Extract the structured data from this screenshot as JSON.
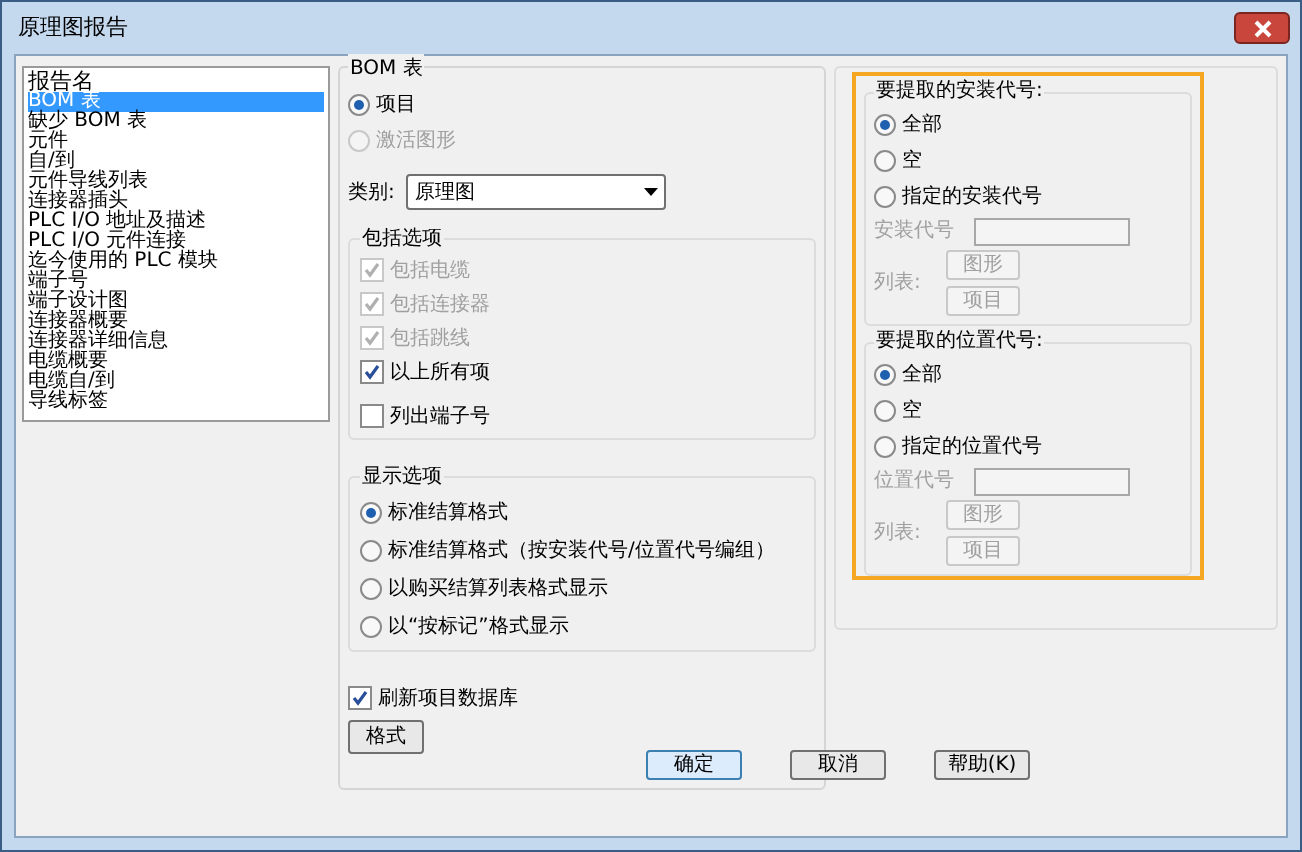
{
  "window": {
    "title": "原理图报告"
  },
  "report_list": {
    "label": "报告名",
    "items": [
      {
        "label": "BOM 表",
        "selected": true
      },
      {
        "label": "缺少 BOM 表",
        "selected": false
      },
      {
        "label": "元件",
        "selected": false
      },
      {
        "label": "自/到",
        "selected": false
      },
      {
        "label": "元件导线列表",
        "selected": false
      },
      {
        "label": "连接器插头",
        "selected": false
      },
      {
        "label": "PLC I/O 地址及描述",
        "selected": false
      },
      {
        "label": "PLC I/O 元件连接",
        "selected": false
      },
      {
        "label": "迄今使用的 PLC 模块",
        "selected": false
      },
      {
        "label": "端子号",
        "selected": false
      },
      {
        "label": "端子设计图",
        "selected": false
      },
      {
        "label": "连接器概要",
        "selected": false
      },
      {
        "label": "连接器详细信息",
        "selected": false
      },
      {
        "label": "电缆概要",
        "selected": false
      },
      {
        "label": "电缆自/到",
        "selected": false
      },
      {
        "label": "导线标签",
        "selected": false
      }
    ]
  },
  "bom": {
    "title": "BOM 表",
    "options": [
      {
        "label": "项目",
        "selected": true,
        "disabled": false
      },
      {
        "label": "激活图形",
        "selected": false,
        "disabled": true
      }
    ],
    "category": {
      "label": "类别:",
      "value": "原理图"
    }
  },
  "include_options": {
    "title": "包括选项",
    "items": [
      {
        "label": "包括电缆",
        "checked": true,
        "disabled": true
      },
      {
        "label": "包括连接器",
        "checked": true,
        "disabled": true
      },
      {
        "label": "包括跳线",
        "checked": true,
        "disabled": true
      },
      {
        "label": "以上所有项",
        "checked": true,
        "disabled": false
      },
      {
        "label": "列出端子号",
        "checked": false,
        "disabled": false
      }
    ]
  },
  "display_options": {
    "title": "显示选项",
    "options": [
      {
        "label": "标准结算格式",
        "selected": true
      },
      {
        "label": "标准结算格式（按安装代号/位置代号编组）",
        "selected": false
      },
      {
        "label": "以购买结算列表格式显示",
        "selected": false
      },
      {
        "label": "以“按标记”格式显示",
        "selected": false
      }
    ]
  },
  "refresh": {
    "label": "刷新项目数据库",
    "checked": true
  },
  "format_button": "格式",
  "code_groups": [
    {
      "title": "要提取的安装代号:",
      "options": [
        {
          "label": "全部",
          "selected": true
        },
        {
          "label": "空",
          "selected": false
        },
        {
          "label": "指定的安装代号",
          "selected": false
        }
      ],
      "field_label": "安装代号",
      "list_label": "列表:",
      "buttons": [
        "图形",
        "项目"
      ]
    },
    {
      "title": "要提取的位置代号:",
      "options": [
        {
          "label": "全部",
          "selected": true
        },
        {
          "label": "空",
          "selected": false
        },
        {
          "label": "指定的位置代号",
          "selected": false
        }
      ],
      "field_label": "位置代号",
      "list_label": "列表:",
      "buttons": [
        "图形",
        "项目"
      ]
    }
  ],
  "buttons": [
    {
      "label": "确定",
      "default": true
    },
    {
      "label": "取消",
      "default": false
    },
    {
      "label": "帮助(K)",
      "default": false
    }
  ]
}
